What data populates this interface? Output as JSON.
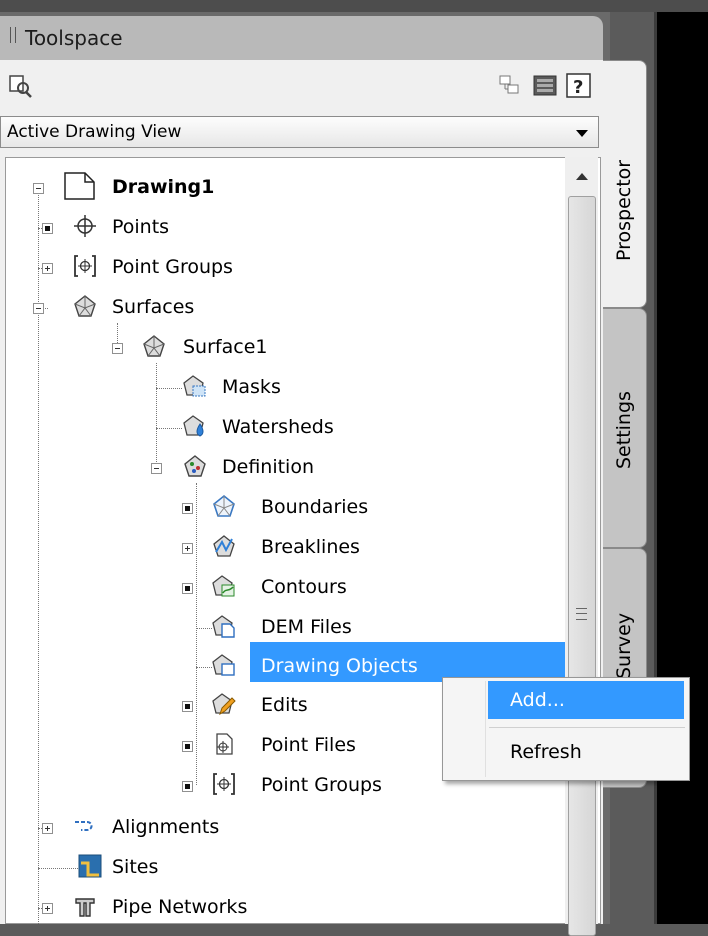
{
  "toolspace": {
    "title": "Toolspace",
    "view_selector": "Active Drawing View"
  },
  "tabs": {
    "prospector": "Prospector",
    "settings": "Settings",
    "survey": "Survey"
  },
  "tree": {
    "drawing": "Drawing1",
    "points": "Points",
    "point_groups": "Point Groups",
    "surfaces": "Surfaces",
    "surface1": "Surface1",
    "masks": "Masks",
    "watersheds": "Watersheds",
    "definition": "Definition",
    "boundaries": "Boundaries",
    "breaklines": "Breaklines",
    "contours": "Contours",
    "dem_files": "DEM Files",
    "drawing_objects": "Drawing Objects",
    "edits": "Edits",
    "point_files": "Point Files",
    "def_point_groups": "Point Groups",
    "alignments": "Alignments",
    "sites": "Sites",
    "pipe_networks": "Pipe Networks"
  },
  "context_menu": {
    "add": "Add...",
    "refresh": "Refresh"
  },
  "colors": {
    "selection": "#3399ff",
    "title_bar": "#b9b9b9"
  }
}
